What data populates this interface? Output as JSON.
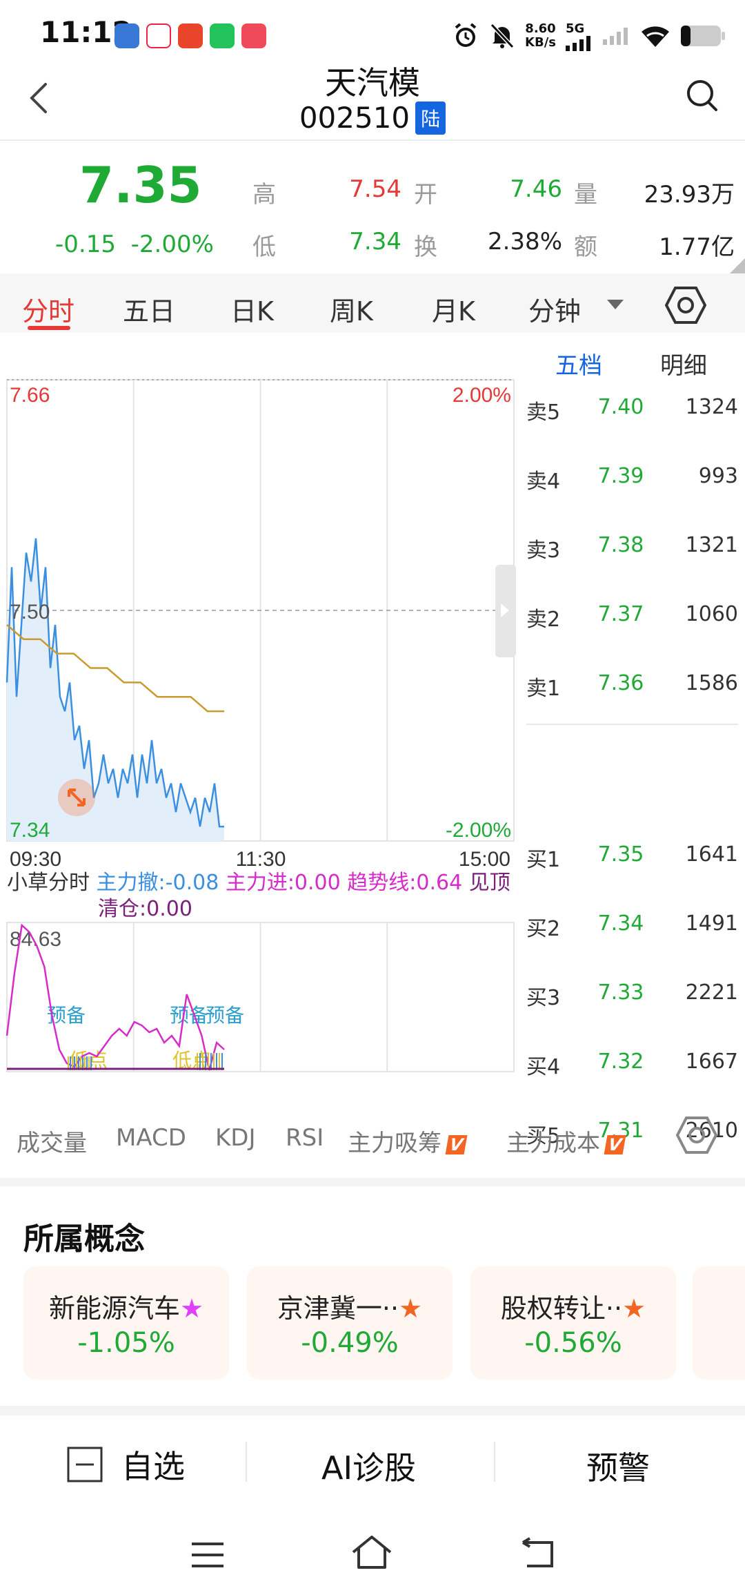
{
  "status_bar": {
    "time": "11:12",
    "network_speed_value": "8.60",
    "network_speed_unit": "KB/s",
    "network_type": "5G",
    "icons": [
      "alarm-icon",
      "mute-icon",
      "signal-icon",
      "wifi-icon",
      "battery-icon"
    ]
  },
  "header": {
    "stock_name": "天汽模",
    "stock_code": "002510",
    "market_badge": "陆"
  },
  "quote": {
    "price": "7.35",
    "change": "-0.15",
    "change_pct": "-2.00%",
    "labels": {
      "high": "高",
      "open": "开",
      "volume": "量",
      "low": "低",
      "turnover": "换",
      "amount": "额"
    },
    "values": {
      "high": "7.54",
      "open": "7.46",
      "volume": "23.93万",
      "low": "7.34",
      "turnover": "2.38%",
      "amount": "1.77亿"
    }
  },
  "tabs": [
    "分时",
    "五日",
    "日K",
    "周K",
    "月K",
    "分钟"
  ],
  "active_tab": "分时",
  "chart_data": {
    "type": "line",
    "y_axis_labels": {
      "top_left": "7.66",
      "mid_left": "7.50",
      "bottom_left": "7.34",
      "top_right": "2.00%",
      "bottom_right": "-2.00%"
    },
    "x_axis_labels": [
      "09:30",
      "11:30",
      "15:00"
    ],
    "ylim": [
      7.34,
      7.66
    ],
    "price_series": [
      7.45,
      7.53,
      7.44,
      7.49,
      7.54,
      7.52,
      7.55,
      7.5,
      7.53,
      7.46,
      7.49,
      7.44,
      7.43,
      7.45,
      7.41,
      7.42,
      7.39,
      7.41,
      7.37,
      7.38,
      7.4,
      7.38,
      7.39,
      7.37,
      7.39,
      7.38,
      7.4,
      7.37,
      7.4,
      7.38,
      7.41,
      7.38,
      7.39,
      7.37,
      7.38,
      7.36,
      7.38,
      7.37,
      7.36,
      7.37,
      7.35,
      7.37,
      7.36,
      7.38,
      7.35,
      7.35
    ],
    "avg_series": [
      7.49,
      7.48,
      7.48,
      7.47,
      7.47,
      7.46,
      7.46,
      7.45,
      7.45,
      7.44,
      7.44,
      7.44,
      7.43,
      7.43
    ],
    "indicator_top_value": "84.63",
    "indicator_labels": [
      "预备",
      "预备",
      "预备",
      "低点",
      "低点"
    ]
  },
  "indicator_legend": {
    "name": "小草分时",
    "main_retreat": "主力撤:-0.08",
    "main_enter": "主力进:0.00",
    "trend_line": "趋势线:0.64",
    "top_signal": "见顶",
    "clear_position": "清仓:0.00"
  },
  "order_book": {
    "tabs": [
      "五档",
      "明细"
    ],
    "active_tab": "五档",
    "sell": [
      {
        "label": "卖5",
        "price": "7.40",
        "volume": "1324"
      },
      {
        "label": "卖4",
        "price": "7.39",
        "volume": "993"
      },
      {
        "label": "卖3",
        "price": "7.38",
        "volume": "1321"
      },
      {
        "label": "卖2",
        "price": "7.37",
        "volume": "1060"
      },
      {
        "label": "卖1",
        "price": "7.36",
        "volume": "1586"
      }
    ],
    "buy": [
      {
        "label": "买1",
        "price": "7.35",
        "volume": "1641"
      },
      {
        "label": "买2",
        "price": "7.34",
        "volume": "1491"
      },
      {
        "label": "买3",
        "price": "7.33",
        "volume": "2221"
      },
      {
        "label": "买4",
        "price": "7.32",
        "volume": "1667"
      },
      {
        "label": "买5",
        "price": "7.31",
        "volume": "2610"
      }
    ]
  },
  "indicator_tabs": [
    "成交量",
    "MACD",
    "KDJ",
    "RSI",
    "主力吸筹",
    "主力成本"
  ],
  "vip_badge": "V",
  "concepts": {
    "title": "所属概念",
    "items": [
      {
        "name": "新能源汽车",
        "pct": "-1.05%",
        "star_color": "#e040fb"
      },
      {
        "name": "京津冀一··",
        "pct": "-0.49%",
        "star_color": "#f26522"
      },
      {
        "name": "股权转让··",
        "pct": "-0.56%",
        "star_color": "#f26522"
      }
    ]
  },
  "actions": {
    "watchlist": "自选",
    "ai": "AI诊股",
    "alert": "预警"
  },
  "colors": {
    "up": "#e53935",
    "down": "#1fa935",
    "price_line": "#3b8fe0",
    "avg_line": "#c99a2e",
    "accent_blue": "#1565e0"
  }
}
